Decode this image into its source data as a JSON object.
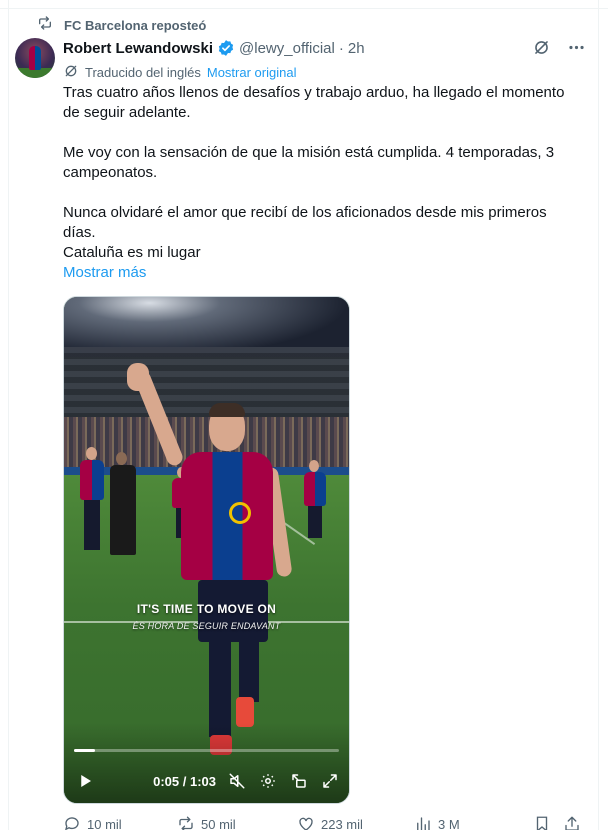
{
  "repost": {
    "text": "FC Barcelona reposteó",
    "icon": "repost-icon"
  },
  "author": {
    "name": "Robert Lewandowski",
    "handle": "@lewy_official",
    "separator": "·",
    "time": "2h",
    "verified": true,
    "avatar": "avatar"
  },
  "translation": {
    "label": "Traducido del inglés",
    "show_original": "Mostrar original"
  },
  "tweet": {
    "paragraphs": [
      "Tras cuatro años llenos de desafíos y trabajo arduo, ha llegado el momento de seguir adelante.",
      "Me voy con la sensación de que la misión está cumplida. 4 temporadas, 3 campeonatos.",
      "Nunca olvidaré el amor que recibí de los aficionados desde mis primeros días.",
      "Cataluña es mi lugar"
    ],
    "show_more": "Mostrar más"
  },
  "video": {
    "caption": "IT'S TIME TO MOVE ON",
    "caption_sub": "ÉS HORA DE SEGUIR ENDAVANT",
    "time": "0:05 / 1:03",
    "progress": 0.08,
    "icons": [
      "play-icon",
      "mute-icon",
      "settings-icon",
      "pip-icon",
      "fullscreen-icon"
    ]
  },
  "actions": {
    "replies": "10 mil",
    "reposts": "50 mil",
    "likes": "223 mil",
    "views": "3 M"
  },
  "colors": {
    "accent": "#1d9bf0",
    "secondary_text": "#536471",
    "primary_text": "#0f1419",
    "verified": "#1d9bf0"
  }
}
